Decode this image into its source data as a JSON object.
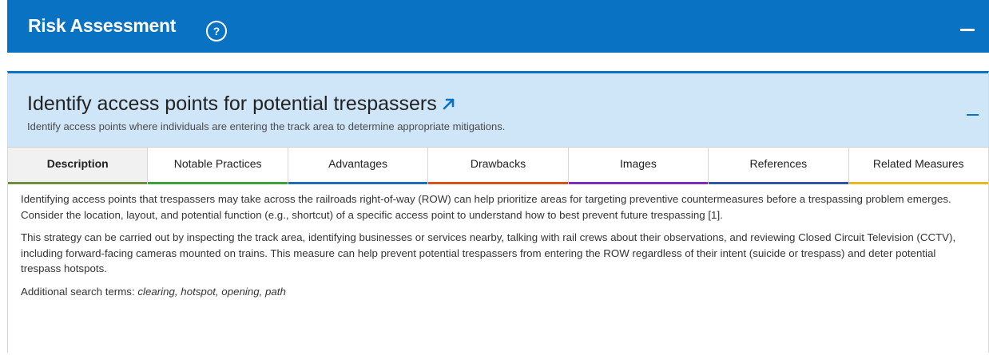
{
  "risk_section": {
    "title": "Risk Assessment",
    "help_icon": "?",
    "collapse_icon": "minus-icon"
  },
  "measure": {
    "title": "Identify access points for potential trespassers",
    "external_link_icon": "external-link-icon",
    "subtitle": "Identify access points where individuals are entering the track area to determine appropriate mitigations.",
    "collapse_icon": "minus-icon"
  },
  "tabs": [
    {
      "label": "Description",
      "color": "#6f8f3f",
      "active": true
    },
    {
      "label": "Notable Practices",
      "color": "#3da23d",
      "active": false
    },
    {
      "label": "Advantages",
      "color": "#1c6fb8",
      "active": false
    },
    {
      "label": "Drawbacks",
      "color": "#d9531e",
      "active": false
    },
    {
      "label": "Images",
      "color": "#7b2fbf",
      "active": false
    },
    {
      "label": "References",
      "color": "#2f55a4",
      "active": false
    },
    {
      "label": "Related Measures",
      "color": "#e9b923",
      "active": false
    }
  ],
  "content": {
    "paragraph1": "Identifying access points that trespassers may take across the railroads right-of-way (ROW) can help prioritize areas for targeting preventive countermeasures before a trespassing problem emerges. Consider the location, layout, and potential function (e.g., shortcut) of a specific access point to understand how to best prevent future trespassing [1].",
    "paragraph2": "This strategy can be carried out by inspecting the track area, identifying businesses or services nearby, talking with rail crews about their observations, and reviewing Closed Circuit Television (CCTV), including forward-facing cameras mounted on trains. This measure can help prevent potential trespassers from entering the ROW regardless of their intent (suicide or trespass) and deter potential trespass hotspots.",
    "search_terms_label": "Additional search terms: ",
    "search_terms": "clearing, hotspot, opening, path"
  },
  "colors": {
    "primary_blue": "#0a72c3",
    "header_light_blue": "#cfe6f8"
  }
}
